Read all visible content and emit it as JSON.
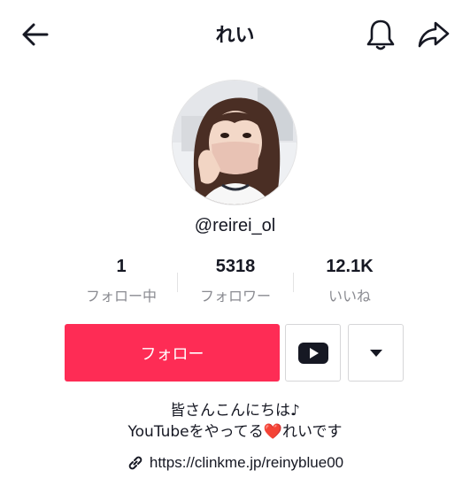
{
  "header": {
    "title": "れい"
  },
  "profile": {
    "username": "@reirei_ol"
  },
  "stats": [
    {
      "value": "1",
      "label": "フォロー中"
    },
    {
      "value": "5318",
      "label": "フォロワー"
    },
    {
      "value": "12.1K",
      "label": "いいね"
    }
  ],
  "actions": {
    "follow_label": "フォロー"
  },
  "bio": {
    "line1": "皆さんこんにちは♪",
    "line2_before": "YouTubeをやってる",
    "line2_heart": "❤️",
    "line2_after": "れいです"
  },
  "link": {
    "text": "https://clinkme.jp/reinyblue00"
  },
  "icons": [
    "back-arrow-icon",
    "bell-icon",
    "share-icon",
    "youtube-icon",
    "caret-down-icon",
    "link-icon"
  ],
  "colors": {
    "accent": "#fe2c55",
    "text": "#161823",
    "muted": "#8a8b91",
    "heart": "#e8322f"
  }
}
